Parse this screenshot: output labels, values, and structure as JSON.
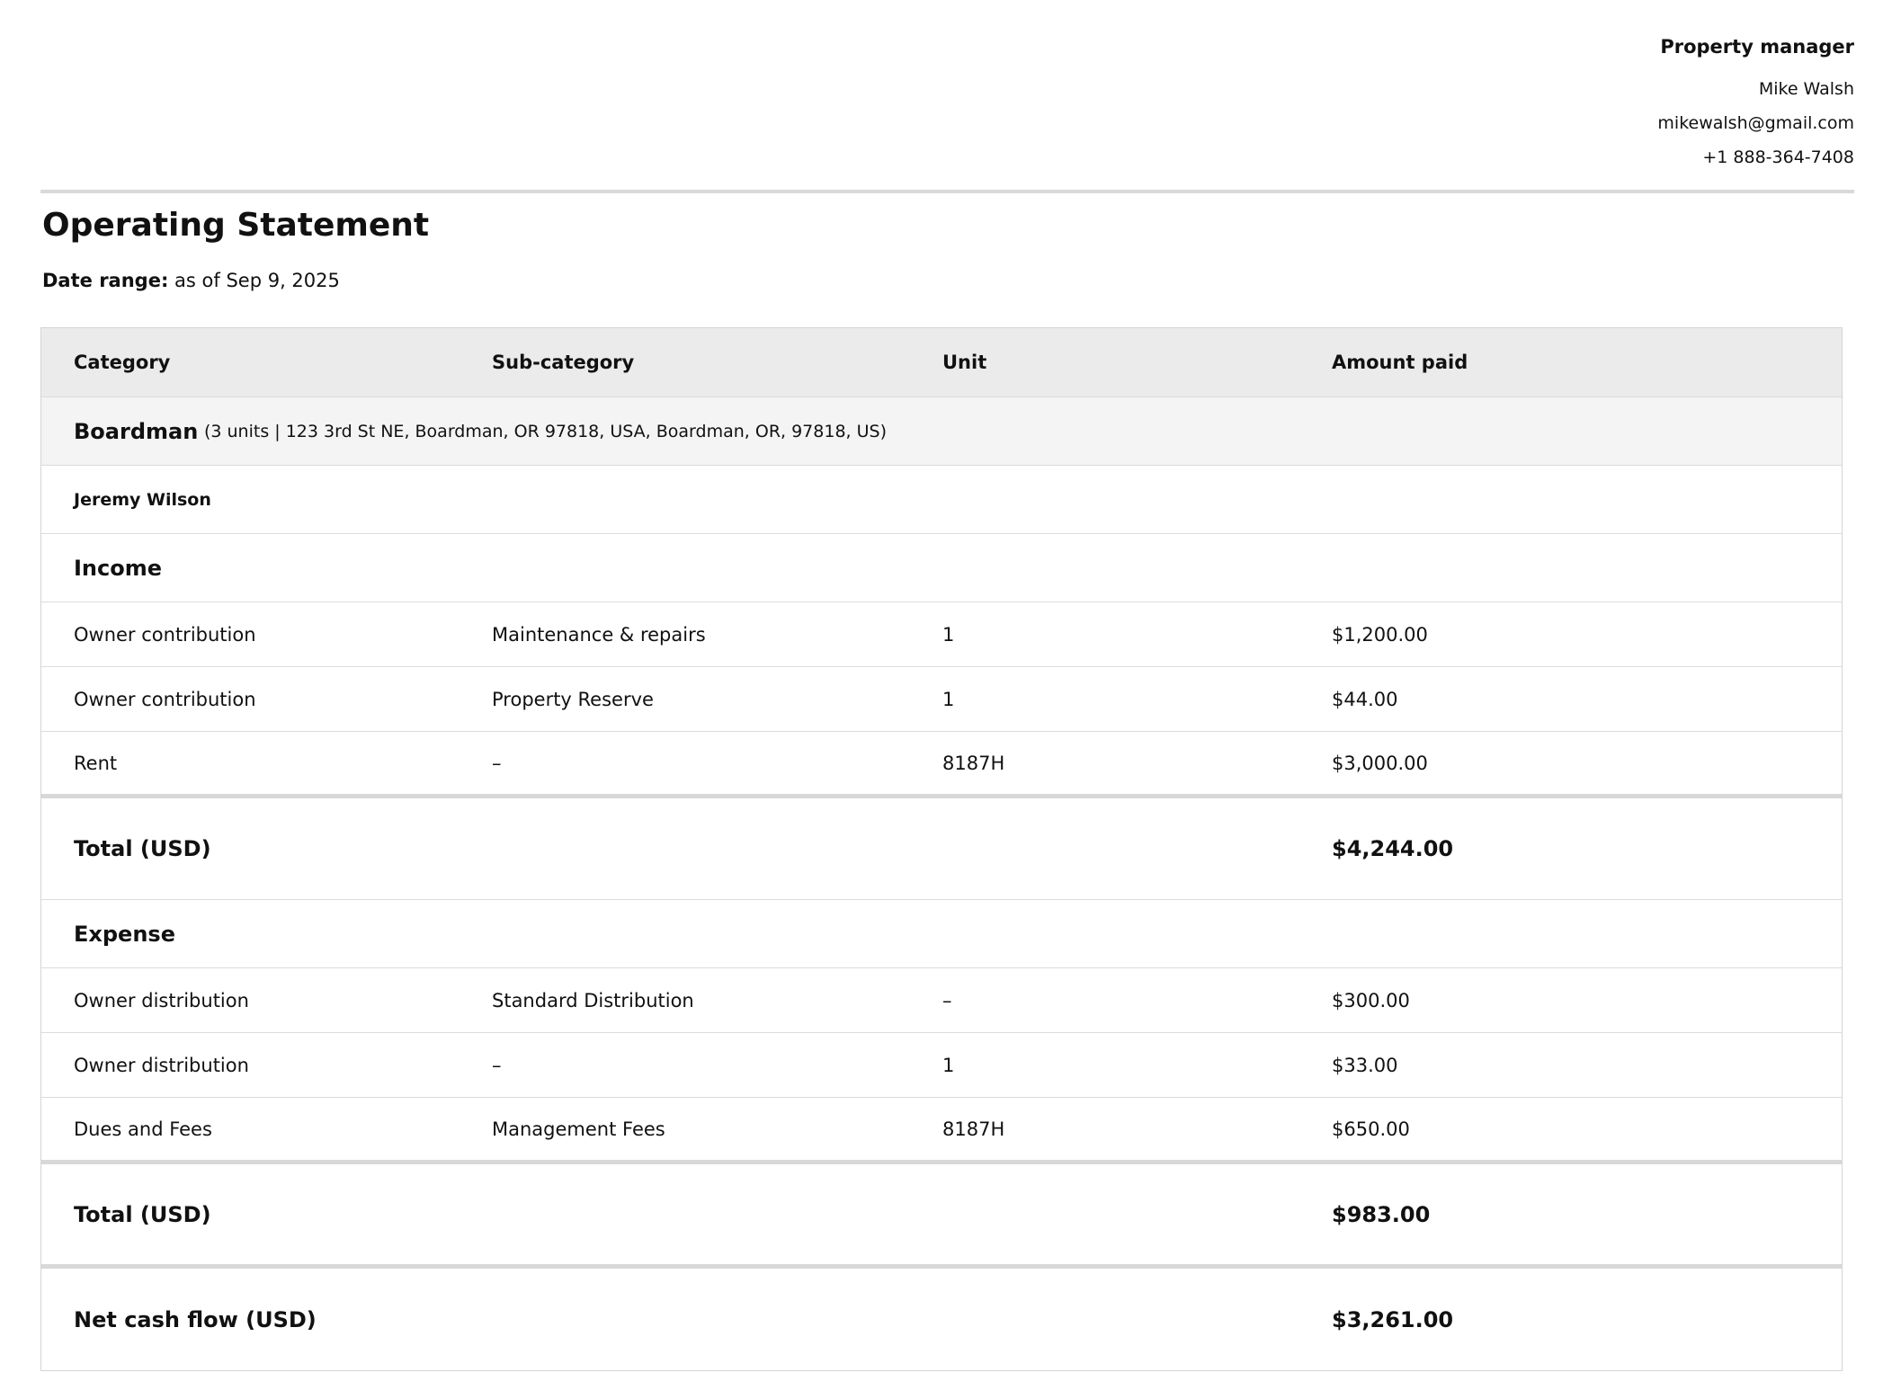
{
  "property_manager": {
    "title": "Property manager",
    "name": "Mike Walsh",
    "email": "mikewalsh@gmail.com",
    "phone": "+1 888-364-7408"
  },
  "document": {
    "title": "Operating Statement",
    "date_range_label": "Date range:",
    "date_range_value": "as of Sep 9, 2025"
  },
  "table": {
    "headers": {
      "category": "Category",
      "subcategory": "Sub-category",
      "unit": "Unit",
      "amount": "Amount paid"
    },
    "property": {
      "name": "Boardman",
      "detail": "(3 units | 123 3rd St NE, Boardman, OR 97818, USA, Boardman, OR, 97818, US)"
    },
    "owner": "Jeremy Wilson",
    "income": {
      "label": "Income",
      "rows": [
        {
          "category": "Owner contribution",
          "subcategory": "Maintenance & repairs",
          "unit": "1",
          "amount": "$1,200.00"
        },
        {
          "category": "Owner contribution",
          "subcategory": "Property Reserve",
          "unit": "1",
          "amount": "$44.00"
        },
        {
          "category": "Rent",
          "subcategory": "–",
          "unit": "8187H",
          "amount": "$3,000.00"
        }
      ],
      "total_label": "Total (USD)",
      "total_value": "$4,244.00"
    },
    "expense": {
      "label": "Expense",
      "rows": [
        {
          "category": "Owner distribution",
          "subcategory": "Standard Distribution",
          "unit": "–",
          "amount": "$300.00"
        },
        {
          "category": "Owner distribution",
          "subcategory": "–",
          "unit": "1",
          "amount": "$33.00"
        },
        {
          "category": "Dues and Fees",
          "subcategory": "Management Fees",
          "unit": "8187H",
          "amount": "$650.00"
        }
      ],
      "total_label": "Total (USD)",
      "total_value": "$983.00"
    },
    "net": {
      "label": "Net cash flow (USD)",
      "value": "$3,261.00"
    }
  }
}
